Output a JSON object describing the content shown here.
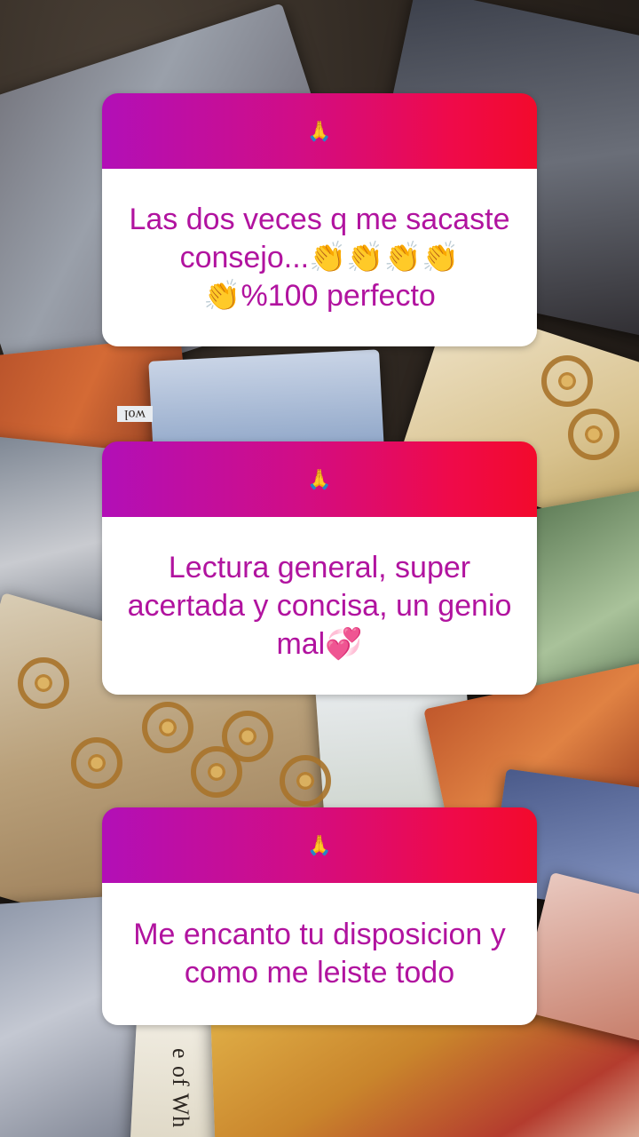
{
  "background": {
    "description_colors": {
      "dark": "#2a2420",
      "gold": "#c9852c",
      "red": "#b43c2e"
    },
    "card_label_small": "wol",
    "card_spine_text": "e of Wh"
  },
  "stickers": [
    {
      "emoji": "🙏",
      "text": "Las dos veces q me sacaste consejo...👏👏👏👏👏%100 perfecto"
    },
    {
      "emoji": "🙏",
      "text": "Lectura general, super acertada y concisa, un genio mal💞"
    },
    {
      "emoji": "🙏",
      "text": "Me encanto tu disposicion y como me leiste todo"
    }
  ],
  "colors": {
    "header_gradient_start": "#b20fb7",
    "header_gradient_end": "#f30a2c",
    "text_color": "#b1139f",
    "body_bg": "#ffffff"
  }
}
